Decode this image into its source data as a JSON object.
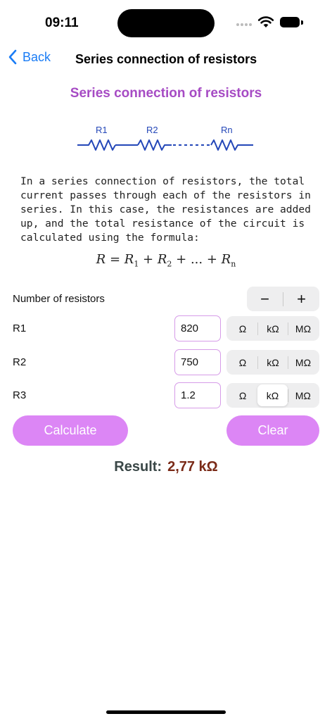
{
  "status": {
    "time": "09:11"
  },
  "nav": {
    "back_label": "Back",
    "title": "Series connection of resistors"
  },
  "heading": "Series connection of resistors",
  "diagram": {
    "labels": [
      "R1",
      "R2",
      "Rn"
    ],
    "color": "#2447b8"
  },
  "description": "In a series connection of resistors, the total current passes through each of the resistors in series. In this case, the resistances are added up, and the total resistance of the circuit is calculated using the formula:",
  "formula": {
    "lhs": "R",
    "eq": " = ",
    "t1": "R",
    "s1": "1",
    "plus": " + ",
    "t2": "R",
    "s2": "2",
    "dots": "...",
    "tn": "R",
    "sn": "n"
  },
  "count": {
    "label": "Number of resistors",
    "minus": "−",
    "plus": "+"
  },
  "resistors": [
    {
      "label": "R1",
      "value": "820",
      "unit": "Ω"
    },
    {
      "label": "R2",
      "value": "750",
      "unit": "Ω"
    },
    {
      "label": "R3",
      "value": "1.2",
      "unit": "kΩ"
    }
  ],
  "units": [
    "Ω",
    "kΩ",
    "MΩ"
  ],
  "buttons": {
    "calculate": "Calculate",
    "clear": "Clear"
  },
  "result": {
    "label": "Result:",
    "value": "2,77 kΩ"
  },
  "colors": {
    "accent": "#dc86f5",
    "heading": "#a64bc4",
    "link": "#1a7cf5",
    "result_value": "#7a2a17"
  }
}
